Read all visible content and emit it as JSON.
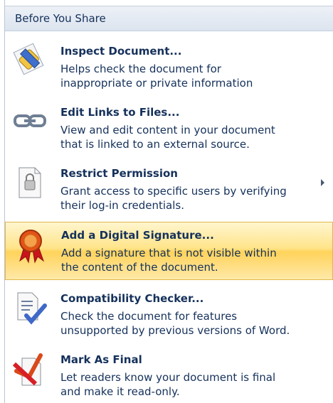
{
  "header": {
    "title": "Before You Share"
  },
  "items": [
    {
      "title": "Inspect Document...",
      "desc1": "Helps check the document for",
      "desc2": "inappropriate or private information",
      "icon": "inspect-eraser-icon"
    },
    {
      "title": "Edit Links to Files...",
      "desc1": "View and edit content in your document",
      "desc2": "that is linked to an external source.",
      "icon": "chain-link-icon"
    },
    {
      "title": "Restrict Permission",
      "desc1": "Grant access to specific users by verifying",
      "desc2": "their log-in credentials.",
      "icon": "document-lock-icon",
      "has_submenu": true
    },
    {
      "title": "Add a Digital Signature...",
      "desc1": "Add a signature that is not visible within",
      "desc2": "the content of the document.",
      "icon": "signature-ribbon-icon",
      "highlighted": true
    },
    {
      "title": "Compatibility Checker...",
      "desc1": "Check the document for features",
      "desc2": "unsupported by previous versions of Word.",
      "icon": "document-check-icon"
    },
    {
      "title": "Mark As Final",
      "desc1": "Let readers know your document is final",
      "desc2": "and make it read-only.",
      "icon": "mark-final-icon"
    }
  ],
  "colors": {
    "text": "#15315b",
    "highlight_start": "#fff6cf",
    "highlight_end": "#ffd35b",
    "header_bg": "#dce4ef"
  }
}
